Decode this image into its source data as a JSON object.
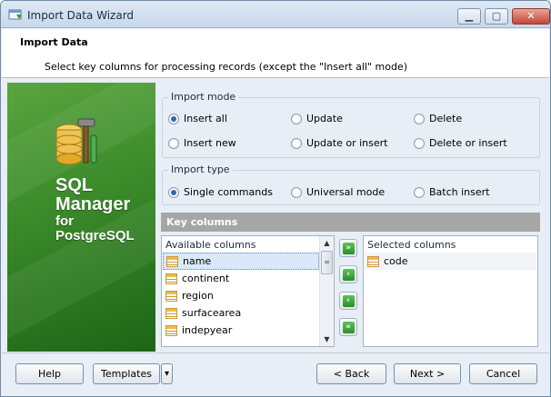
{
  "window": {
    "title": "Import Data Wizard",
    "minimize": "▁",
    "maximize": "▢",
    "close": "✕"
  },
  "header": {
    "title": "Import Data",
    "subtitle": "Select key columns for processing records (except the \"Insert all\" mode)"
  },
  "banner": {
    "line1": "SQL",
    "line2": "Manager",
    "line3": "for",
    "line4": "PostgreSQL"
  },
  "import_mode": {
    "title": "Import mode",
    "options": [
      "Insert all",
      "Update",
      "Delete",
      "Insert new",
      "Update or insert",
      "Delete or insert"
    ],
    "selected": "Insert all"
  },
  "import_type": {
    "title": "Import type",
    "options": [
      "Single commands",
      "Universal mode",
      "Batch insert"
    ],
    "selected": "Single commands"
  },
  "key_columns": {
    "title": "Key columns",
    "available_header": "Available columns",
    "available": [
      "name",
      "continent",
      "region",
      "surfacearea",
      "indepyear"
    ],
    "selected_available": "name",
    "selected_header": "Selected columns",
    "selected": [
      "code"
    ]
  },
  "move_buttons": [
    "»",
    "›",
    "‹",
    "«"
  ],
  "footer": {
    "help": "Help",
    "templates": "Templates",
    "templates_dropdown": "▾",
    "back": "< Back",
    "next": "Next >",
    "cancel": "Cancel"
  }
}
